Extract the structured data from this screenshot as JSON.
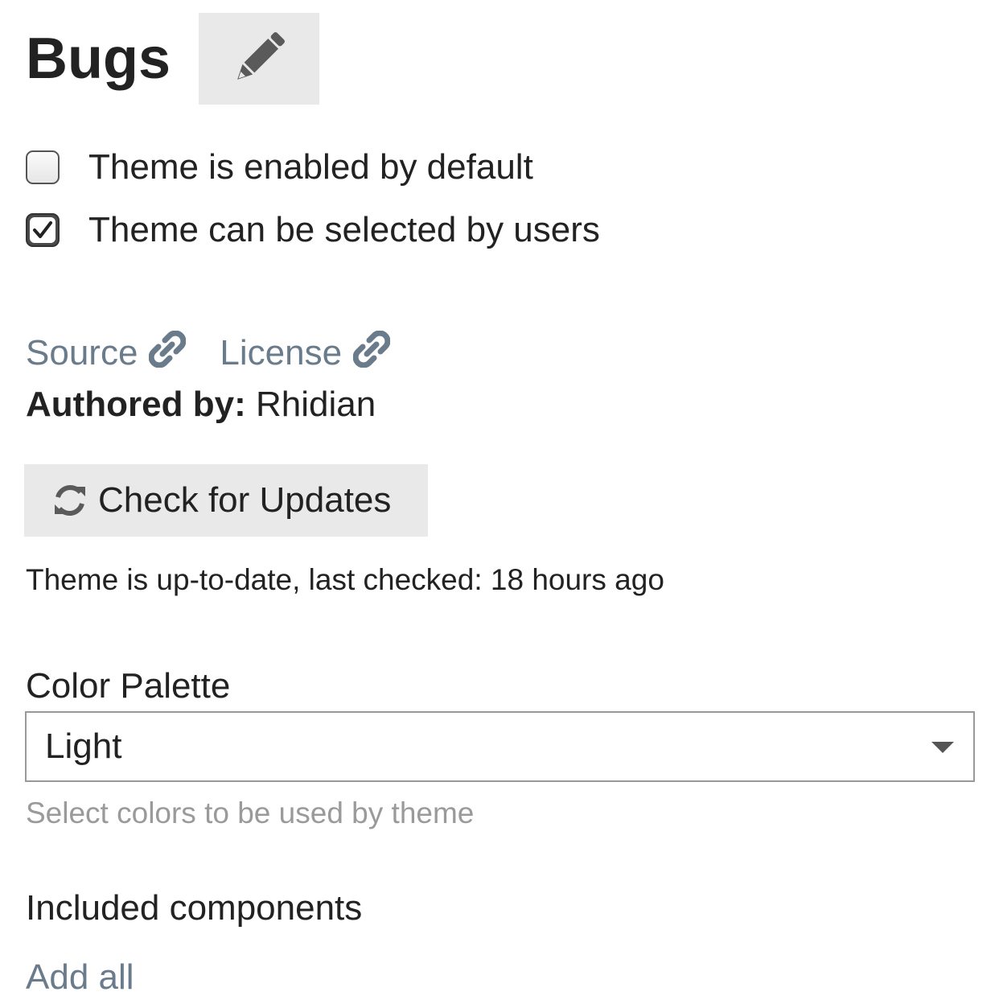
{
  "header": {
    "title": "Bugs",
    "edit_icon": "pencil-icon"
  },
  "settings": {
    "enabled_default": {
      "label": "Theme is enabled by default",
      "checked": false
    },
    "user_selectable": {
      "label": "Theme can be selected by users",
      "checked": true
    }
  },
  "links": {
    "source": {
      "label": "Source",
      "icon": "link-icon"
    },
    "license": {
      "label": "License",
      "icon": "link-icon"
    }
  },
  "author": {
    "prefix": "Authored by:",
    "name": "Rhidian"
  },
  "updates": {
    "button_label": "Check for Updates",
    "icon": "refresh-icon",
    "status": "Theme is up-to-date, last checked: 18 hours ago"
  },
  "color_palette": {
    "label": "Color Palette",
    "selected": "Light",
    "hint": "Select colors to be used by theme"
  },
  "components": {
    "heading": "Included components",
    "add_all_label": "Add all"
  },
  "colors": {
    "link": "#6a7b8b",
    "button_bg": "#e9e9e9",
    "text": "#222222",
    "hint": "#9a9a9a"
  }
}
